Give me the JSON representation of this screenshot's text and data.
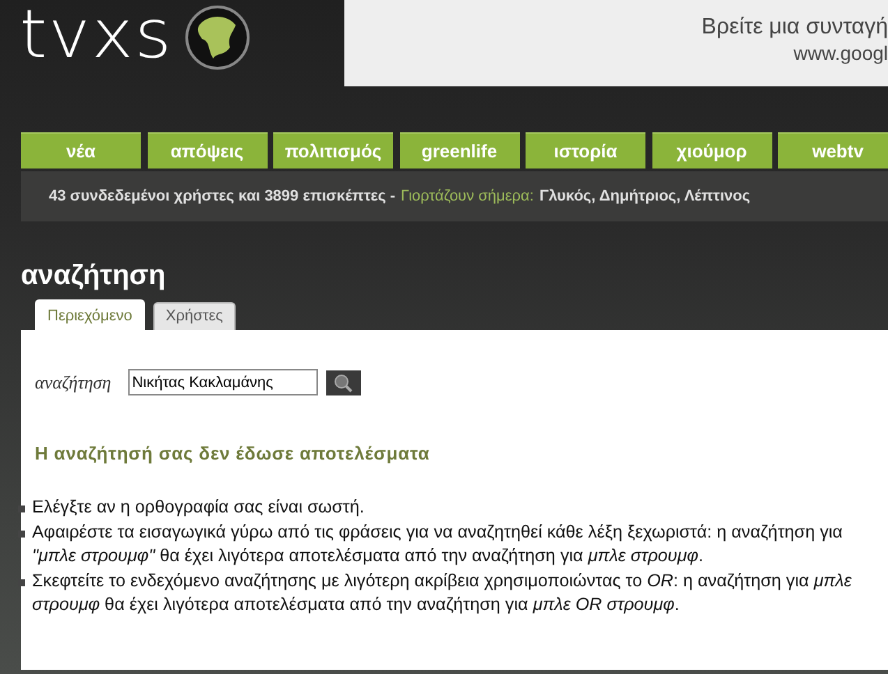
{
  "logo": {
    "text": "tvxs"
  },
  "ad": {
    "lines": [
      "Βρείτε μια συνταγή",
      "www.googl"
    ]
  },
  "nav": [
    {
      "label": "νέα"
    },
    {
      "label": "απόψεις"
    },
    {
      "label": "πολιτισμός"
    },
    {
      "label": "greenlife"
    },
    {
      "label": "ιστορία"
    },
    {
      "label": "χιούμορ"
    },
    {
      "label": "webtv"
    }
  ],
  "info": {
    "stats": "43 συνδεδεμένοι χρήστες και 3899 επισκέπτες -",
    "nameday_label": "Γιορτάζουν σήμερα:",
    "names": "Γλυκός, Δημήτριος, Λέπτινος"
  },
  "page_title": "αναζήτηση",
  "tabs": [
    {
      "label": "Περιεχόμενο",
      "selected": true
    },
    {
      "label": "Χρήστες",
      "selected": false
    }
  ],
  "search": {
    "label": "αναζήτηση",
    "value": "Νικήτας Κακλαμάνης"
  },
  "result_heading": "Η αναζήτησή σας δεν έδωσε αποτελέσματα",
  "tips": [
    "Ελέγξτε αν η ορθογραφία σας είναι σωστή.",
    "Αφαιρέστε τα εισαγωγικά γύρω από τις φράσεις για να αναζητηθεί κάθε λέξη ξεχωριστά: η αναζήτηση για *\"μπλε στρουμφ\"* θα έχει λιγότερα αποτελέσματα από την αναζήτηση για *μπλε στρουμφ*.",
    "Σκεφτείτε το ενδεχόμενο αναζήτησης με λιγότερη ακρίβεια χρησιμοποιώντας το *OR*: η αναζήτηση για *μπλε στρουμφ* θα έχει λιγότερα αποτελέσματα από την αναζήτηση για *μπλε OR στρουμφ*."
  ]
}
